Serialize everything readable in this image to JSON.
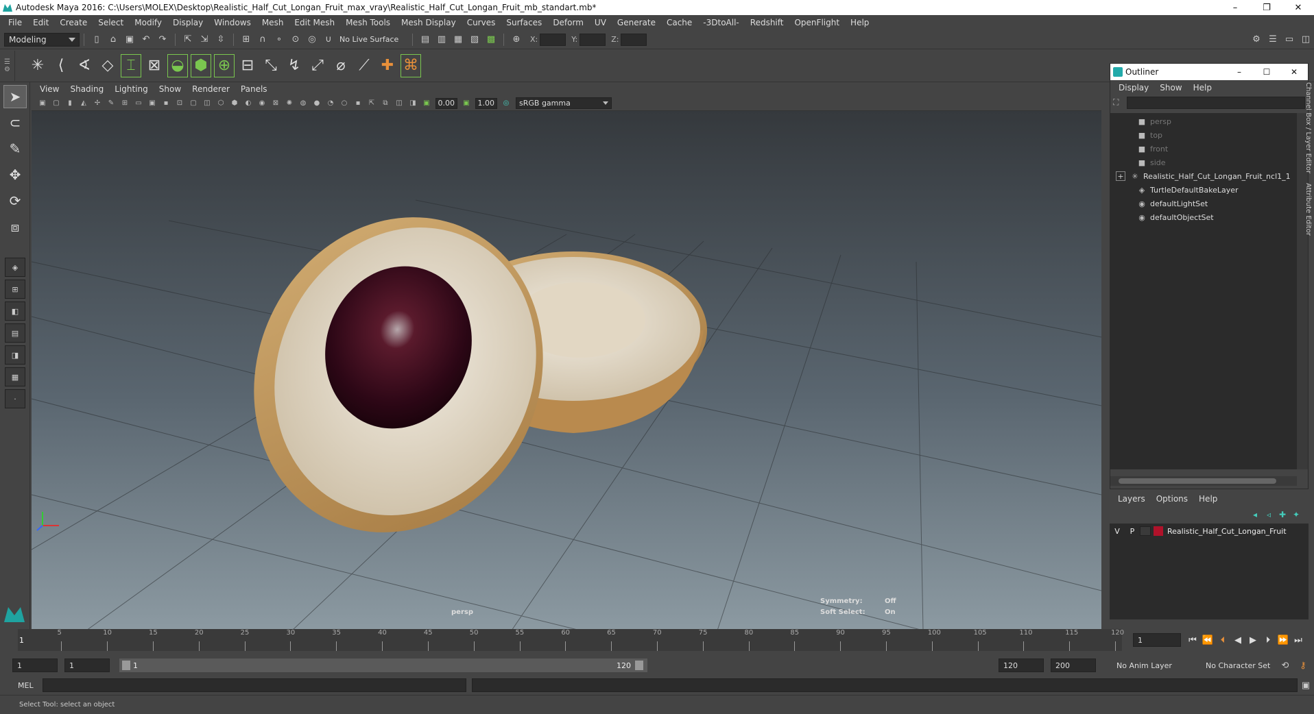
{
  "window": {
    "title": "Autodesk Maya 2016: C:\\Users\\MOLEX\\Desktop\\Realistic_Half_Cut_Longan_Fruit_max_vray\\Realistic_Half_Cut_Longan_Fruit_mb_standart.mb*",
    "controls": [
      "–",
      "❐",
      "✕"
    ]
  },
  "menubar": [
    "File",
    "Edit",
    "Create",
    "Select",
    "Modify",
    "Display",
    "Windows",
    "Mesh",
    "Edit Mesh",
    "Mesh Tools",
    "Mesh Display",
    "Curves",
    "Surfaces",
    "Deform",
    "UV",
    "Generate",
    "Cache",
    "-3DtoAll-",
    "Redshift",
    "OpenFlight",
    "Help"
  ],
  "statusline": {
    "mode": "Modeling",
    "live_surface": "No Live Surface",
    "x_label": "X:",
    "y_label": "Y:",
    "z_label": "Z:"
  },
  "panel": {
    "menus": [
      "View",
      "Shading",
      "Lighting",
      "Show",
      "Renderer",
      "Panels"
    ],
    "exposure": "0.00",
    "gamma": "1.00",
    "color_space": "sRGB gamma"
  },
  "viewport": {
    "camera": "persp",
    "symmetry_label": "Symmetry:",
    "symmetry_value": "Off",
    "soft_select_label": "Soft Select:",
    "soft_select_value": "On"
  },
  "outliner": {
    "title": "Outliner",
    "menus": [
      "Display",
      "Show",
      "Help"
    ],
    "items": [
      {
        "label": "persp",
        "icon": "camera-icon",
        "dim": true
      },
      {
        "label": "top",
        "icon": "camera-icon",
        "dim": true
      },
      {
        "label": "front",
        "icon": "camera-icon",
        "dim": true
      },
      {
        "label": "side",
        "icon": "camera-icon",
        "dim": true
      },
      {
        "label": "Realistic_Half_Cut_Longan_Fruit_ncl1_1",
        "icon": "transform-icon",
        "expandable": true
      },
      {
        "label": "TurtleDefaultBakeLayer",
        "icon": "node-icon"
      },
      {
        "label": "defaultLightSet",
        "icon": "set-icon"
      },
      {
        "label": "defaultObjectSet",
        "icon": "set-icon"
      }
    ]
  },
  "right_tabs": [
    "Channel Box / Layer Editor",
    "Attribute Editor"
  ],
  "layers": {
    "menus": [
      "Layers",
      "Options",
      "Help"
    ],
    "rows": [
      {
        "v": "V",
        "p": "P",
        "name": "Realistic_Half_Cut_Longan_Fruit",
        "color": "#b0122a"
      }
    ]
  },
  "timeline": {
    "ticks": [
      "5",
      "10",
      "15",
      "20",
      "25",
      "30",
      "35",
      "40",
      "45",
      "50",
      "55",
      "60",
      "65",
      "70",
      "75",
      "80",
      "85",
      "90",
      "95",
      "100",
      "105",
      "110",
      "115",
      "120"
    ],
    "start_label": "1",
    "current_frame": "1"
  },
  "range": {
    "start": "1",
    "playback_start": "1",
    "range_start": "1",
    "range_end": "120",
    "playback_end": "120",
    "end": "200",
    "anim_layer": "No Anim Layer",
    "character_set": "No Character Set"
  },
  "cmdline": {
    "language": "MEL"
  },
  "helpline": {
    "text": "Select Tool: select an object"
  },
  "colors": {
    "accent": "#7ac74f",
    "layer_color": "#b0122a"
  }
}
